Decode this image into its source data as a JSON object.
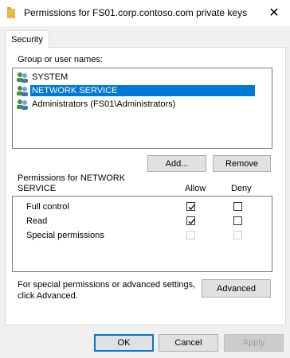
{
  "window": {
    "title": "Permissions for FS01.corp.contoso.com private keys",
    "close_glyph": "✕"
  },
  "tab": {
    "label": "Security"
  },
  "groups": {
    "label": "Group or user names:",
    "items": [
      {
        "name": "SYSTEM",
        "selected": false
      },
      {
        "name": "NETWORK SERVICE",
        "selected": true
      },
      {
        "name": "Administrators (FS01\\Administrators)",
        "selected": false
      }
    ]
  },
  "buttons": {
    "add": "Add...",
    "remove": "Remove",
    "advanced": "Advanced",
    "ok": "OK",
    "cancel": "Cancel",
    "apply": "Apply"
  },
  "permissions": {
    "label_line1": "Permissions for NETWORK",
    "label_line2": "SERVICE",
    "col_allow": "Allow",
    "col_deny": "Deny",
    "rows": [
      {
        "name": "Full control",
        "allow": true,
        "deny": false,
        "enabled": true
      },
      {
        "name": "Read",
        "allow": true,
        "deny": false,
        "enabled": true
      },
      {
        "name": "Special permissions",
        "allow": false,
        "deny": false,
        "enabled": false
      }
    ]
  },
  "advanced_text": {
    "line1": "For special permissions or advanced settings,",
    "line2": "click Advanced."
  },
  "colors": {
    "selection": "#0078d7",
    "folder": "#e8b94a"
  }
}
